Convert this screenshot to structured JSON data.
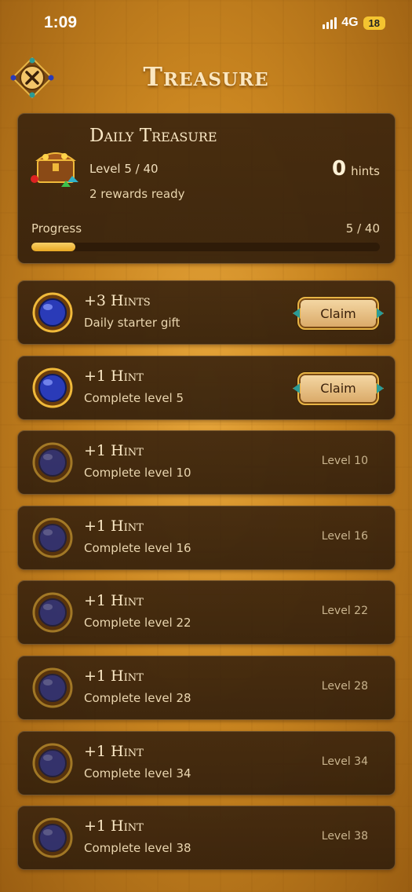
{
  "status": {
    "time": "1:09",
    "network": "4G",
    "battery": "18"
  },
  "header": {
    "title": "Treasure"
  },
  "daily": {
    "title": "Daily Treasure",
    "level": "Level 5 / 40",
    "ready": "2 rewards ready",
    "hints_count": "0",
    "hints_unit": "hints",
    "progress_label": "Progress",
    "progress_value": "5 / 40",
    "progress_fraction": 0.125
  },
  "rewards": [
    {
      "title": "+3 Hints",
      "subtitle": "Daily starter gift",
      "claim": "Claim",
      "state": "claimable"
    },
    {
      "title": "+1 Hint",
      "subtitle": "Complete level 5",
      "claim": "Claim",
      "state": "claimable"
    },
    {
      "title": "+1 Hint",
      "subtitle": "Complete level 10",
      "level": "Level 10",
      "state": "locked"
    },
    {
      "title": "+1 Hint",
      "subtitle": "Complete level 16",
      "level": "Level 16",
      "state": "locked"
    },
    {
      "title": "+1 Hint",
      "subtitle": "Complete level 22",
      "level": "Level 22",
      "state": "locked"
    },
    {
      "title": "+1 Hint",
      "subtitle": "Complete level 28",
      "level": "Level 28",
      "state": "locked"
    },
    {
      "title": "+1 Hint",
      "subtitle": "Complete level 34",
      "level": "Level 34",
      "state": "locked"
    },
    {
      "title": "+1 Hint",
      "subtitle": "Complete level 38",
      "level": "Level 38",
      "state": "locked"
    }
  ],
  "colors": {
    "accent": "#e9a823",
    "panel": "#3e260e",
    "gem": "#2a3bb8"
  }
}
